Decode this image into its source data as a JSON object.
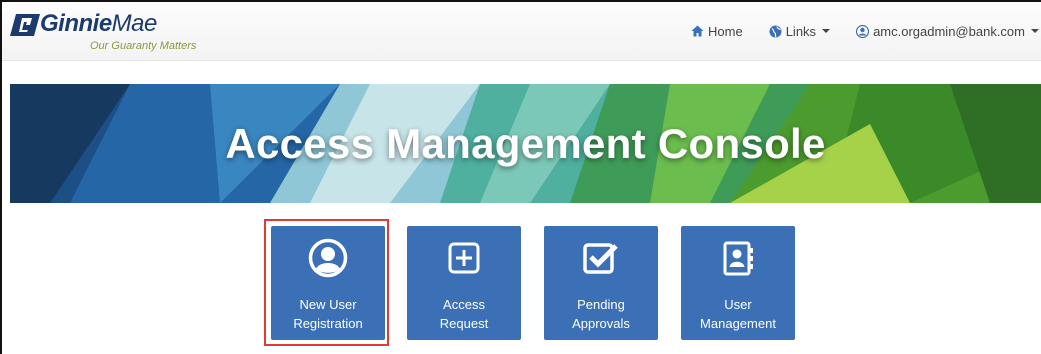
{
  "brand": {
    "name_bold": "Ginnie",
    "name_regular": "Mae",
    "tagline": "Our Guaranty Matters"
  },
  "nav": {
    "home_label": "Home",
    "links_label": "Links",
    "user_email": "amc.orgadmin@bank.com"
  },
  "banner": {
    "title": "Access Management Console"
  },
  "tiles": [
    {
      "label_line1": "New User",
      "label_line2": "Registration",
      "icon": "user-circle-icon",
      "highlighted": true
    },
    {
      "label_line1": "Access",
      "label_line2": "Request",
      "icon": "plus-square-icon",
      "highlighted": false
    },
    {
      "label_line1": "Pending",
      "label_line2": "Approvals",
      "icon": "check-square-icon",
      "highlighted": false
    },
    {
      "label_line1": "User",
      "label_line2": "Management",
      "icon": "address-book-icon",
      "highlighted": false
    }
  ],
  "colors": {
    "tile": "#3b6fb6",
    "highlight_border": "#e03b3b",
    "brand_blue": "#1b3a6e",
    "tagline_green": "#8a9a3a"
  }
}
